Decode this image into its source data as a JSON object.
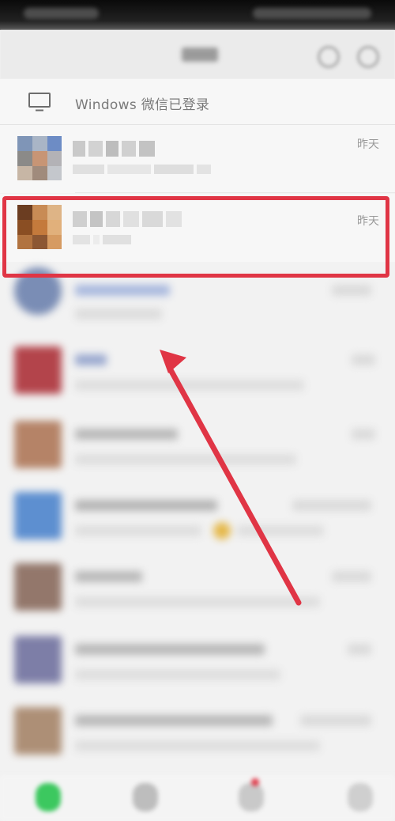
{
  "banner": {
    "windows_login_text": "Windows 微信已登录"
  },
  "chats": [
    {
      "time": "昨天"
    },
    {
      "time": "昨天"
    }
  ],
  "colors": {
    "annotation_red": "#e03545",
    "wechat_green": "#3cc85f"
  },
  "icons": {
    "monitor": "monitor-icon"
  }
}
